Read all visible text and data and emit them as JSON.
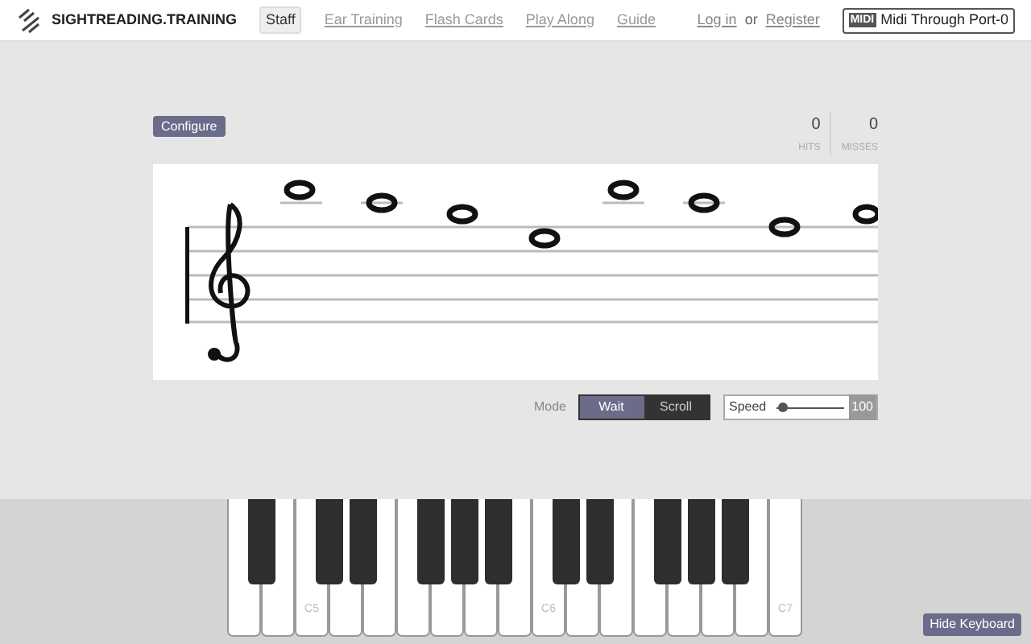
{
  "brand": "SIGHTREADING.TRAINING",
  "nav": [
    {
      "label": "Staff",
      "selected": true
    },
    {
      "label": "Ear Training",
      "selected": false
    },
    {
      "label": "Flash Cards",
      "selected": false
    },
    {
      "label": "Play Along",
      "selected": false
    },
    {
      "label": "Guide",
      "selected": false
    }
  ],
  "auth": {
    "login": "Log in",
    "or": "or",
    "register": "Register"
  },
  "midi_device": {
    "badge": "MIDI",
    "label": "Midi Through Port-0"
  },
  "configure_button": "Configure",
  "stats": [
    {
      "value": "0",
      "label": "HITS"
    },
    {
      "value": "0",
      "label": "MISSES"
    }
  ],
  "mode": {
    "label": "Mode",
    "options": [
      {
        "label": "Wait",
        "selected": true
      },
      {
        "label": "Scroll",
        "selected": false
      }
    ]
  },
  "speed": {
    "label": "Speed",
    "level": 0.1,
    "reading": "100"
  },
  "keys": [
    {
      "black_after": true
    },
    {
      "black_after": false
    },
    {
      "label": "C5",
      "black_after": true
    },
    {
      "black_after": true
    },
    {
      "black_after": false
    },
    {
      "black_after": true
    },
    {
      "black_after": true
    },
    {
      "black_after": true
    },
    {
      "black_after": false
    },
    {
      "label": "C6",
      "black_after": true
    },
    {
      "black_after": true
    },
    {
      "black_after": false
    },
    {
      "black_after": true
    },
    {
      "black_after": true
    },
    {
      "black_after": true
    },
    {
      "black_after": false
    },
    {
      "label": "C7",
      "black_after": false
    }
  ],
  "hide_keyboard_button": "Hide Keyboard"
}
